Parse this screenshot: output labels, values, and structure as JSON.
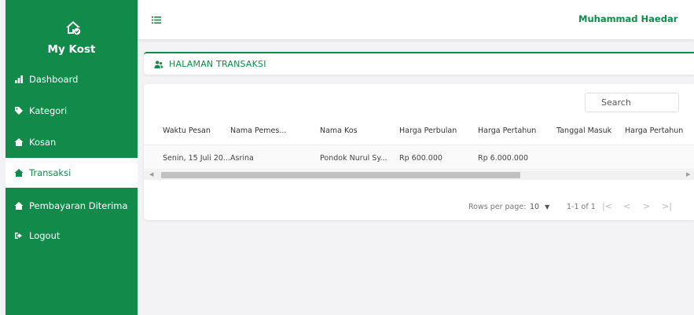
{
  "brand": {
    "title": "My Kost",
    "icon": "home-check-icon"
  },
  "sidebar": {
    "items": [
      {
        "label": "Dashboard",
        "icon": "bar-chart-icon"
      },
      {
        "label": "Kategori",
        "icon": "tag-icon"
      },
      {
        "label": "Kosan",
        "icon": "house-icon"
      },
      {
        "label": "Transaksi",
        "icon": "house-icon",
        "active": true
      },
      {
        "label": "Pembayaran Diterima",
        "icon": "house-icon"
      },
      {
        "label": "Logout",
        "icon": "sign-out-icon"
      }
    ]
  },
  "topbar": {
    "user_name": "Muhammad Haedar",
    "menu_icon": "list-icon"
  },
  "page": {
    "title": "HALAMAN TRANSAKSI",
    "icon": "users-icon"
  },
  "table": {
    "search_placeholder": "Search",
    "columns": [
      "Waktu Pesan",
      "Nama Pemes...",
      "Nama Kos",
      "Harga Perbulan",
      "Harga Pertahun",
      "Tanggal Masuk",
      "Harga Pertahun"
    ],
    "rows": [
      [
        "Senin, 15 Juli 20...",
        "Asrina",
        "Pondok Nurul Sy...",
        "Rp 600.000",
        "Rp 6.000.000",
        "",
        ""
      ]
    ]
  },
  "pagination": {
    "rows_per_page_label": "Rows per page:",
    "rows_per_page_value": "10",
    "range": "1-1 of 1",
    "first": "|<",
    "prev": "<",
    "next": ">",
    "last": ">|"
  },
  "colors": {
    "primary": "#128a4a",
    "background": "#f3f3f5"
  }
}
